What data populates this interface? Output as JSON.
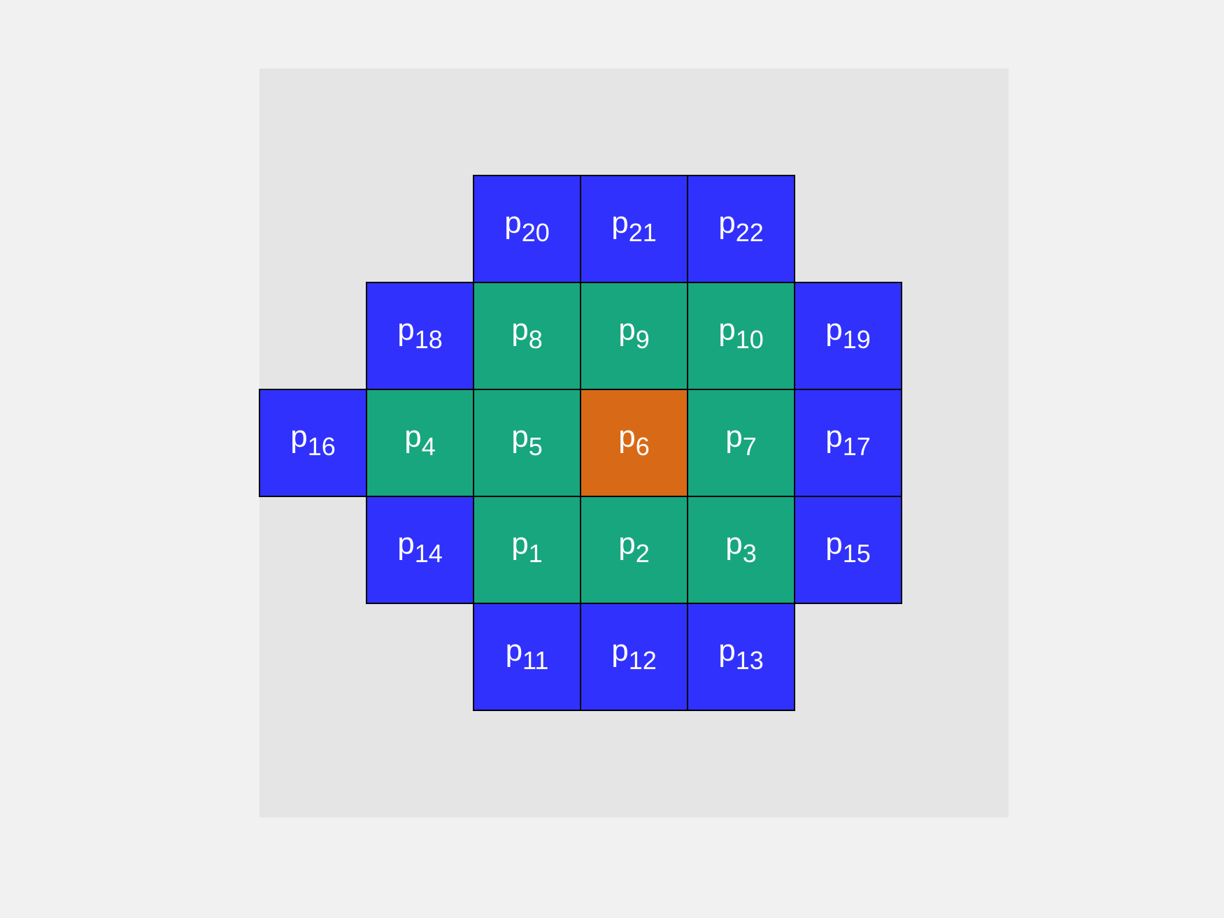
{
  "colors": {
    "page_background": "#f1f1f1",
    "panel_background": "#e5e5e5",
    "center": "#d86a17",
    "inner_ring": "#18a67e",
    "outer_ring": "#3131fd",
    "label": "#ffffff",
    "border": "#000000"
  },
  "cells": [
    {
      "id": "p20",
      "row": 0,
      "col": 2,
      "base": "p",
      "sub": "20",
      "ring": "outer_ring"
    },
    {
      "id": "p21",
      "row": 0,
      "col": 3,
      "base": "p",
      "sub": "21",
      "ring": "outer_ring"
    },
    {
      "id": "p22",
      "row": 0,
      "col": 4,
      "base": "p",
      "sub": "22",
      "ring": "outer_ring"
    },
    {
      "id": "p18",
      "row": 1,
      "col": 1,
      "base": "p",
      "sub": "18",
      "ring": "outer_ring"
    },
    {
      "id": "p8",
      "row": 1,
      "col": 2,
      "base": "p",
      "sub": "8",
      "ring": "inner_ring"
    },
    {
      "id": "p9",
      "row": 1,
      "col": 3,
      "base": "p",
      "sub": "9",
      "ring": "inner_ring"
    },
    {
      "id": "p10",
      "row": 1,
      "col": 4,
      "base": "p",
      "sub": "10",
      "ring": "inner_ring"
    },
    {
      "id": "p19",
      "row": 1,
      "col": 5,
      "base": "p",
      "sub": "19",
      "ring": "outer_ring"
    },
    {
      "id": "p16",
      "row": 2,
      "col": 0,
      "base": "p",
      "sub": "16",
      "ring": "outer_ring"
    },
    {
      "id": "p4",
      "row": 2,
      "col": 1,
      "base": "p",
      "sub": "4",
      "ring": "inner_ring"
    },
    {
      "id": "p5",
      "row": 2,
      "col": 2,
      "base": "p",
      "sub": "5",
      "ring": "inner_ring"
    },
    {
      "id": "p6",
      "row": 2,
      "col": 3,
      "base": "p",
      "sub": "6",
      "ring": "center"
    },
    {
      "id": "p7",
      "row": 2,
      "col": 4,
      "base": "p",
      "sub": "7",
      "ring": "inner_ring"
    },
    {
      "id": "p17",
      "row": 2,
      "col": 5,
      "base": "p",
      "sub": "17",
      "ring": "outer_ring"
    },
    {
      "id": "p14",
      "row": 3,
      "col": 1,
      "base": "p",
      "sub": "14",
      "ring": "outer_ring"
    },
    {
      "id": "p1",
      "row": 3,
      "col": 2,
      "base": "p",
      "sub": "1",
      "ring": "inner_ring"
    },
    {
      "id": "p2",
      "row": 3,
      "col": 3,
      "base": "p",
      "sub": "2",
      "ring": "inner_ring"
    },
    {
      "id": "p3",
      "row": 3,
      "col": 4,
      "base": "p",
      "sub": "3",
      "ring": "inner_ring"
    },
    {
      "id": "p15",
      "row": 3,
      "col": 5,
      "base": "p",
      "sub": "15",
      "ring": "outer_ring"
    },
    {
      "id": "p11",
      "row": 4,
      "col": 2,
      "base": "p",
      "sub": "11",
      "ring": "outer_ring"
    },
    {
      "id": "p12",
      "row": 4,
      "col": 3,
      "base": "p",
      "sub": "12",
      "ring": "outer_ring"
    },
    {
      "id": "p13",
      "row": 4,
      "col": 4,
      "base": "p",
      "sub": "13",
      "ring": "outer_ring"
    }
  ]
}
